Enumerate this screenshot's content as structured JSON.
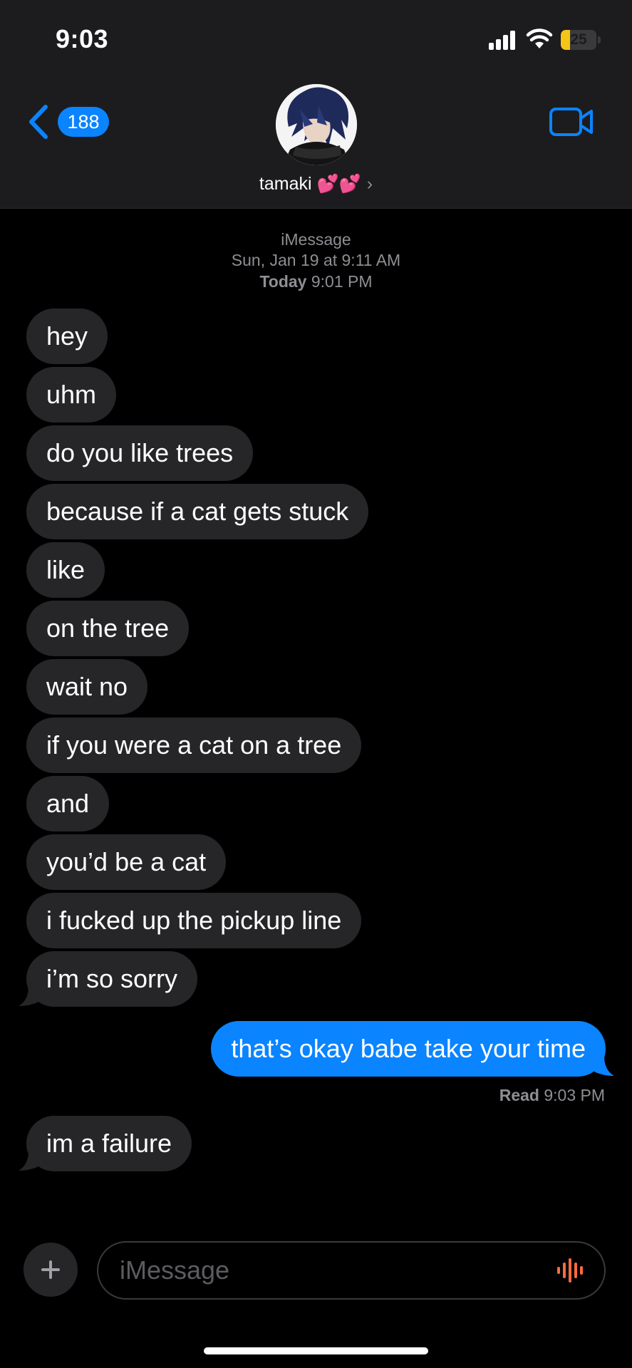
{
  "status_bar": {
    "time": "9:03",
    "battery": "25"
  },
  "header": {
    "back_count": "188",
    "contact_name": "tamaki 💕💕",
    "chevron": "›"
  },
  "meta": {
    "service": "iMessage",
    "first_date": "Sun, Jan 19 at 9:11 AM",
    "today_label": "Today",
    "today_time": "9:01 PM"
  },
  "messages": [
    {
      "text": "hey",
      "from": "them"
    },
    {
      "text": "uhm",
      "from": "them"
    },
    {
      "text": "do you like trees",
      "from": "them"
    },
    {
      "text": "because if a cat gets stuck",
      "from": "them"
    },
    {
      "text": "like",
      "from": "them"
    },
    {
      "text": "on the tree",
      "from": "them"
    },
    {
      "text": "wait no",
      "from": "them"
    },
    {
      "text": "if you were a cat on a tree",
      "from": "them"
    },
    {
      "text": "and",
      "from": "them"
    },
    {
      "text": "you’d be a cat",
      "from": "them"
    },
    {
      "text": "i fucked up the pickup line",
      "from": "them"
    },
    {
      "text": "i’m so sorry",
      "from": "them"
    },
    {
      "text": "that’s okay babe take your time",
      "from": "me"
    },
    {
      "text": "im a failure",
      "from": "them"
    }
  ],
  "read_receipt": {
    "label": "Read",
    "time": "9:03 PM"
  },
  "composer": {
    "placeholder": "iMessage"
  },
  "icons": {
    "back": "chevron-left-icon",
    "video": "video-camera-icon",
    "plus": "plus-icon",
    "mic": "audio-waveform-icon"
  },
  "colors": {
    "accent": "#0a84ff",
    "incoming_bubble": "#262628",
    "header_bg": "#1c1c1e",
    "waveform": "#ff6b3d",
    "battery": "#f5c518"
  }
}
